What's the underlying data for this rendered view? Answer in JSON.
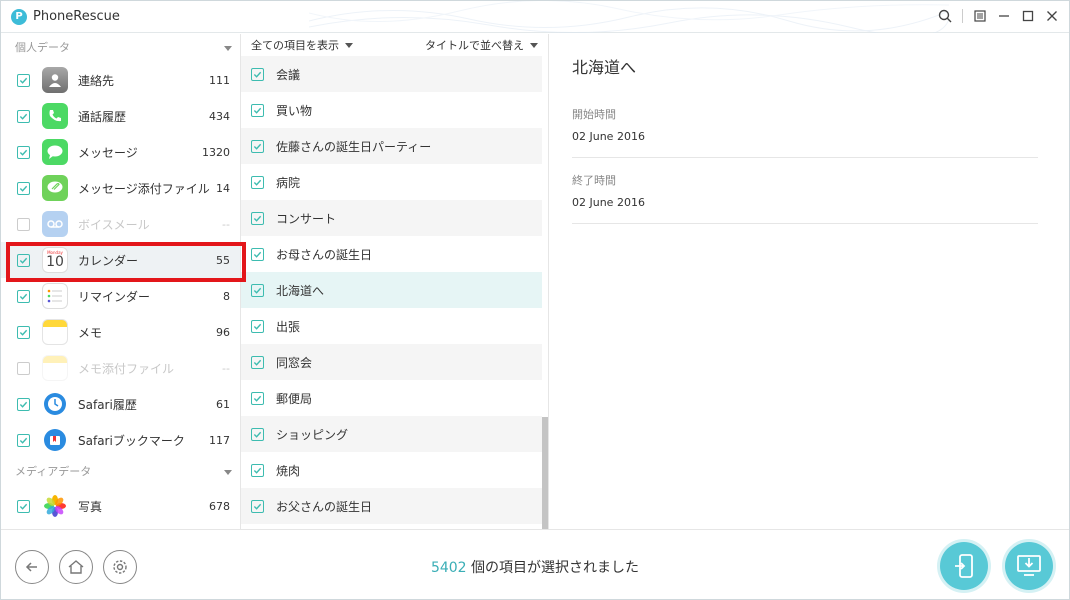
{
  "window": {
    "title": "PhoneRescue",
    "logo_letter": "P"
  },
  "sidebar": {
    "personal_header": "個人データ",
    "media_header": "メディアデータ",
    "items": [
      {
        "label": "連絡先",
        "count": "111",
        "checked": true,
        "icon": "contacts-icon",
        "color": "#8c8c8c"
      },
      {
        "label": "通話履歴",
        "count": "434",
        "checked": true,
        "icon": "phone-icon",
        "color": "#4cd964"
      },
      {
        "label": "メッセージ",
        "count": "1320",
        "checked": true,
        "icon": "messages-icon",
        "color": "#4cd964"
      },
      {
        "label": "メッセージ添付ファイル",
        "count": "14",
        "checked": true,
        "icon": "attachment-icon",
        "color": "#6fd25a"
      },
      {
        "label": "ボイスメール",
        "count": "--",
        "checked": false,
        "icon": "voicemail-icon",
        "color": "#2f7ed8"
      },
      {
        "label": "カレンダー",
        "count": "55",
        "checked": true,
        "icon": "calendar-icon",
        "color": "#ffffff",
        "calendar_day": "Monday",
        "calendar_date": "10"
      },
      {
        "label": "リマインダー",
        "count": "8",
        "checked": true,
        "icon": "reminders-icon",
        "color": "#ffffff"
      },
      {
        "label": "メモ",
        "count": "96",
        "checked": true,
        "icon": "notes-icon",
        "color": "#ffd83a"
      },
      {
        "label": "メモ添付ファイル",
        "count": "--",
        "checked": false,
        "icon": "notes-attachment-icon",
        "color": "#ffd83a"
      },
      {
        "label": "Safari履歴",
        "count": "61",
        "checked": true,
        "icon": "safari-history-icon",
        "color": "#2a8be0"
      },
      {
        "label": "Safariブックマーク",
        "count": "117",
        "checked": true,
        "icon": "safari-bookmark-icon",
        "color": "#2a8be0"
      }
    ],
    "media_items": [
      {
        "label": "写真",
        "count": "678",
        "checked": true,
        "icon": "photos-icon"
      }
    ]
  },
  "list": {
    "filter_label": "全ての項目を表示",
    "sort_label": "タイトルで並べ替え",
    "items": [
      "会議",
      "買い物",
      "佐藤さんの誕生日パーティー",
      "病院",
      "コンサート",
      "お母さんの誕生日",
      "北海道へ",
      "出張",
      "同窓会",
      "郵便局",
      "ショッピング",
      "焼肉",
      "お父さんの誕生日"
    ],
    "selected_index": 6
  },
  "detail": {
    "title": "北海道へ",
    "start_label": "開始時間",
    "start_value": "02 June 2016",
    "end_label": "終了時間",
    "end_value": "02 June 2016"
  },
  "footer": {
    "selected_count": "5402",
    "selected_text": "個の項目が選択されました"
  },
  "colors": {
    "accent": "#3aaeb6",
    "highlight": "#e3161a"
  }
}
